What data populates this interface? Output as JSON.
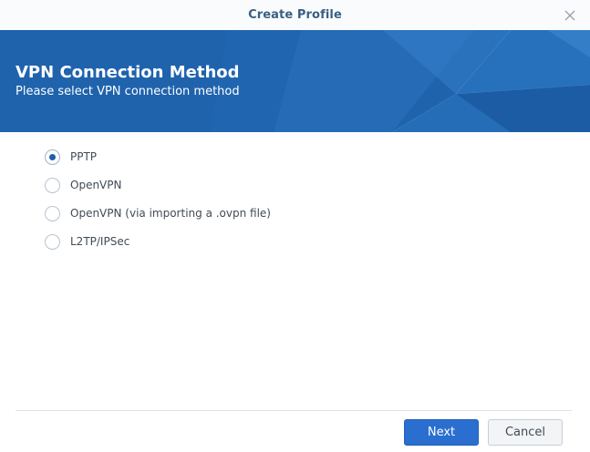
{
  "window": {
    "title": "Create Profile",
    "close_icon": "close-icon"
  },
  "banner": {
    "title": "VPN Connection Method",
    "subtitle": "Please select VPN connection method",
    "color": "#1f63ad"
  },
  "options": [
    {
      "label": "PPTP",
      "selected": true
    },
    {
      "label": "OpenVPN",
      "selected": false
    },
    {
      "label": "OpenVPN (via importing a .ovpn file)",
      "selected": false
    },
    {
      "label": "L2TP/IPSec",
      "selected": false
    }
  ],
  "footer": {
    "next_label": "Next",
    "cancel_label": "Cancel",
    "accent": "#2a6fcf"
  }
}
